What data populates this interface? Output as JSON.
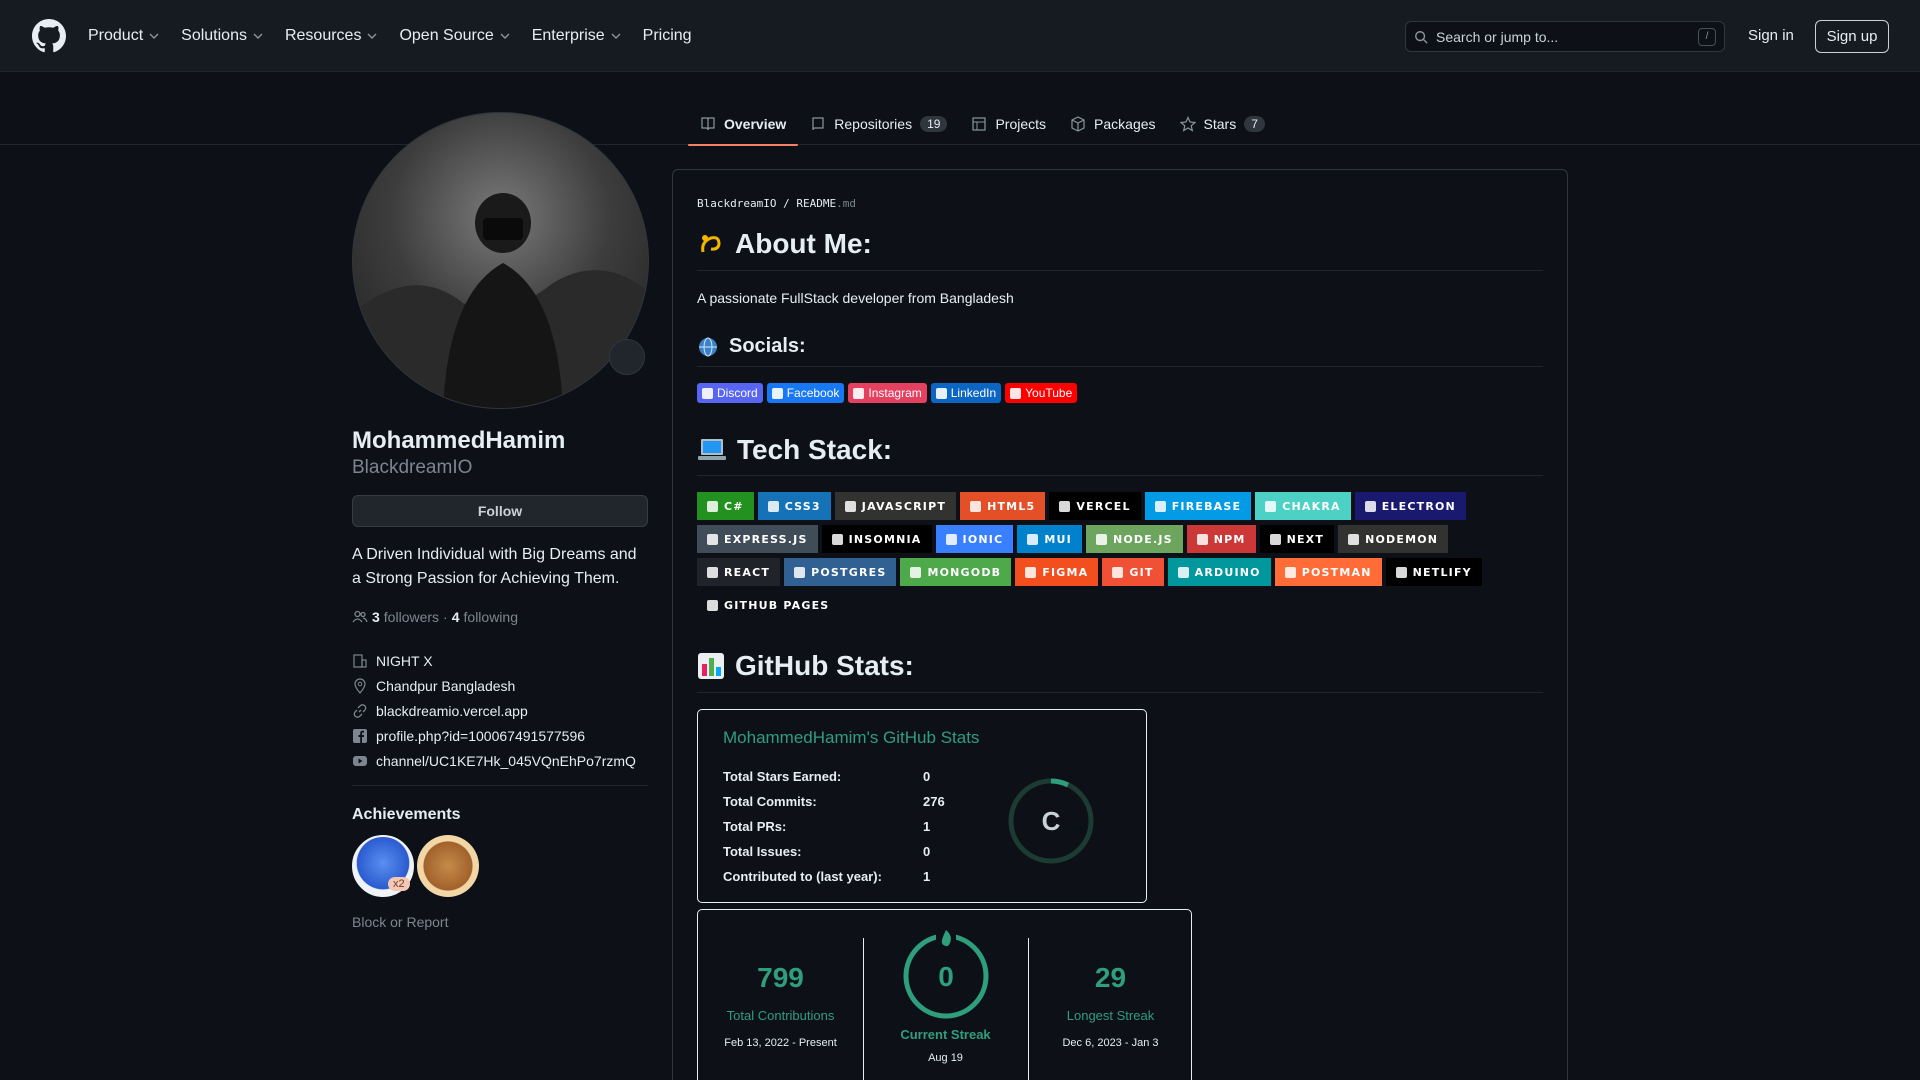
{
  "header": {
    "nav": [
      {
        "label": "Product",
        "dropdown": true
      },
      {
        "label": "Solutions",
        "dropdown": true
      },
      {
        "label": "Resources",
        "dropdown": true
      },
      {
        "label": "Open Source",
        "dropdown": true
      },
      {
        "label": "Enterprise",
        "dropdown": true
      },
      {
        "label": "Pricing",
        "dropdown": false
      }
    ],
    "search_placeholder": "Search or jump to...",
    "search_shortcut": "/",
    "signin": "Sign in",
    "signup": "Sign up"
  },
  "tabs": [
    {
      "label": "Overview",
      "active": true,
      "icon": "book-icon"
    },
    {
      "label": "Repositories",
      "count": "19",
      "icon": "repo-icon"
    },
    {
      "label": "Projects",
      "icon": "table-icon"
    },
    {
      "label": "Packages",
      "icon": "package-icon"
    },
    {
      "label": "Stars",
      "count": "7",
      "icon": "star-icon"
    }
  ],
  "profile": {
    "fullname": "MohammedHamim",
    "login": "BlackdreamIO",
    "follow": "Follow",
    "bio": "A Driven Individual with Big Dreams and a Strong Passion for Achieving Them.",
    "followers_count": "3",
    "followers_label": "followers",
    "dot": "·",
    "following_count": "4",
    "following_label": "following",
    "details": [
      {
        "icon": "organization-icon",
        "text": "NIGHT X"
      },
      {
        "icon": "location-icon",
        "text": "Chandpur Bangladesh"
      },
      {
        "icon": "link-icon",
        "text": "blackdreamio.vercel.app"
      },
      {
        "icon": "facebook-icon",
        "text": "profile.php?id=100067491577596"
      },
      {
        "icon": "youtube-icon",
        "text": "channel/UC1KE7Hk_045VQnEhPo7rzmQ"
      }
    ],
    "achievements_title": "Achievements",
    "achievement_multiplier": "x2",
    "block_report": "Block or Report"
  },
  "readme": {
    "path_owner": "BlackdreamIO",
    "path_sep": " / ",
    "path_file": "README",
    "path_ext": ".md",
    "about_title": "About Me:",
    "about_text": "A passionate FullStack developer from Bangladesh",
    "socials_title": "Socials:",
    "socials": [
      {
        "label": "Discord",
        "color": "#5865F2"
      },
      {
        "label": "Facebook",
        "color": "#1877F2"
      },
      {
        "label": "Instagram",
        "color": "#E4405F"
      },
      {
        "label": "LinkedIn",
        "color": "#0A66C2"
      },
      {
        "label": "YouTube",
        "color": "#FF0000"
      }
    ],
    "stack_title": "Tech Stack:",
    "stack": [
      {
        "label": "C#",
        "color": "#239120"
      },
      {
        "label": "CSS3",
        "color": "#1572B6"
      },
      {
        "label": "JavaScript",
        "color": "#323330"
      },
      {
        "label": "HTML5",
        "color": "#E34F26"
      },
      {
        "label": "Vercel",
        "color": "#000000"
      },
      {
        "label": "Firebase",
        "color": "#039BE5"
      },
      {
        "label": "Chakra",
        "color": "#4ED1C5"
      },
      {
        "label": "Electron",
        "color": "#191970"
      },
      {
        "label": "Express.js",
        "color": "#404d59"
      },
      {
        "label": "Insomnia",
        "color": "#000000"
      },
      {
        "label": "Ionic",
        "color": "#3880FF"
      },
      {
        "label": "MUI",
        "color": "#0081CB"
      },
      {
        "label": "NODE.JS",
        "color": "#6DA55F"
      },
      {
        "label": "NPM",
        "color": "#CB3837"
      },
      {
        "label": "Next",
        "color": "#000000"
      },
      {
        "label": "NODEMON",
        "color": "#323330"
      },
      {
        "label": "React",
        "color": "#20232a"
      },
      {
        "label": "Postgres",
        "color": "#316192"
      },
      {
        "label": "MongoDB",
        "color": "#4ea94b"
      },
      {
        "label": "Figma",
        "color": "#F24E1E"
      },
      {
        "label": "Git",
        "color": "#F05033"
      },
      {
        "label": "Arduino",
        "color": "#00979D"
      },
      {
        "label": "Postman",
        "color": "#FF6C37"
      },
      {
        "label": "Netlify",
        "color": "#000000"
      },
      {
        "label": "Github Pages",
        "color": "#0d1117"
      }
    ],
    "gh_stats_title": "GitHub Stats:",
    "stats_card": {
      "title": "MohammedHamim's GitHub Stats",
      "rows": [
        {
          "k": "Total Stars Earned:",
          "v": "0"
        },
        {
          "k": "Total Commits:",
          "v": "276"
        },
        {
          "k": "Total PRs:",
          "v": "1"
        },
        {
          "k": "Total Issues:",
          "v": "0"
        },
        {
          "k": "Contributed to (last year):",
          "v": "1"
        }
      ],
      "grade": "C",
      "accent": "#2f9e7c"
    },
    "streak_card": {
      "total": "799",
      "total_label": "Total Contributions",
      "total_range": "Feb 13, 2022 - Present",
      "current": "0",
      "current_label": "Current Streak",
      "current_date": "Aug 19",
      "longest": "29",
      "longest_label": "Longest Streak",
      "longest_range": "Dec 6, 2023 - Jan 3"
    }
  }
}
